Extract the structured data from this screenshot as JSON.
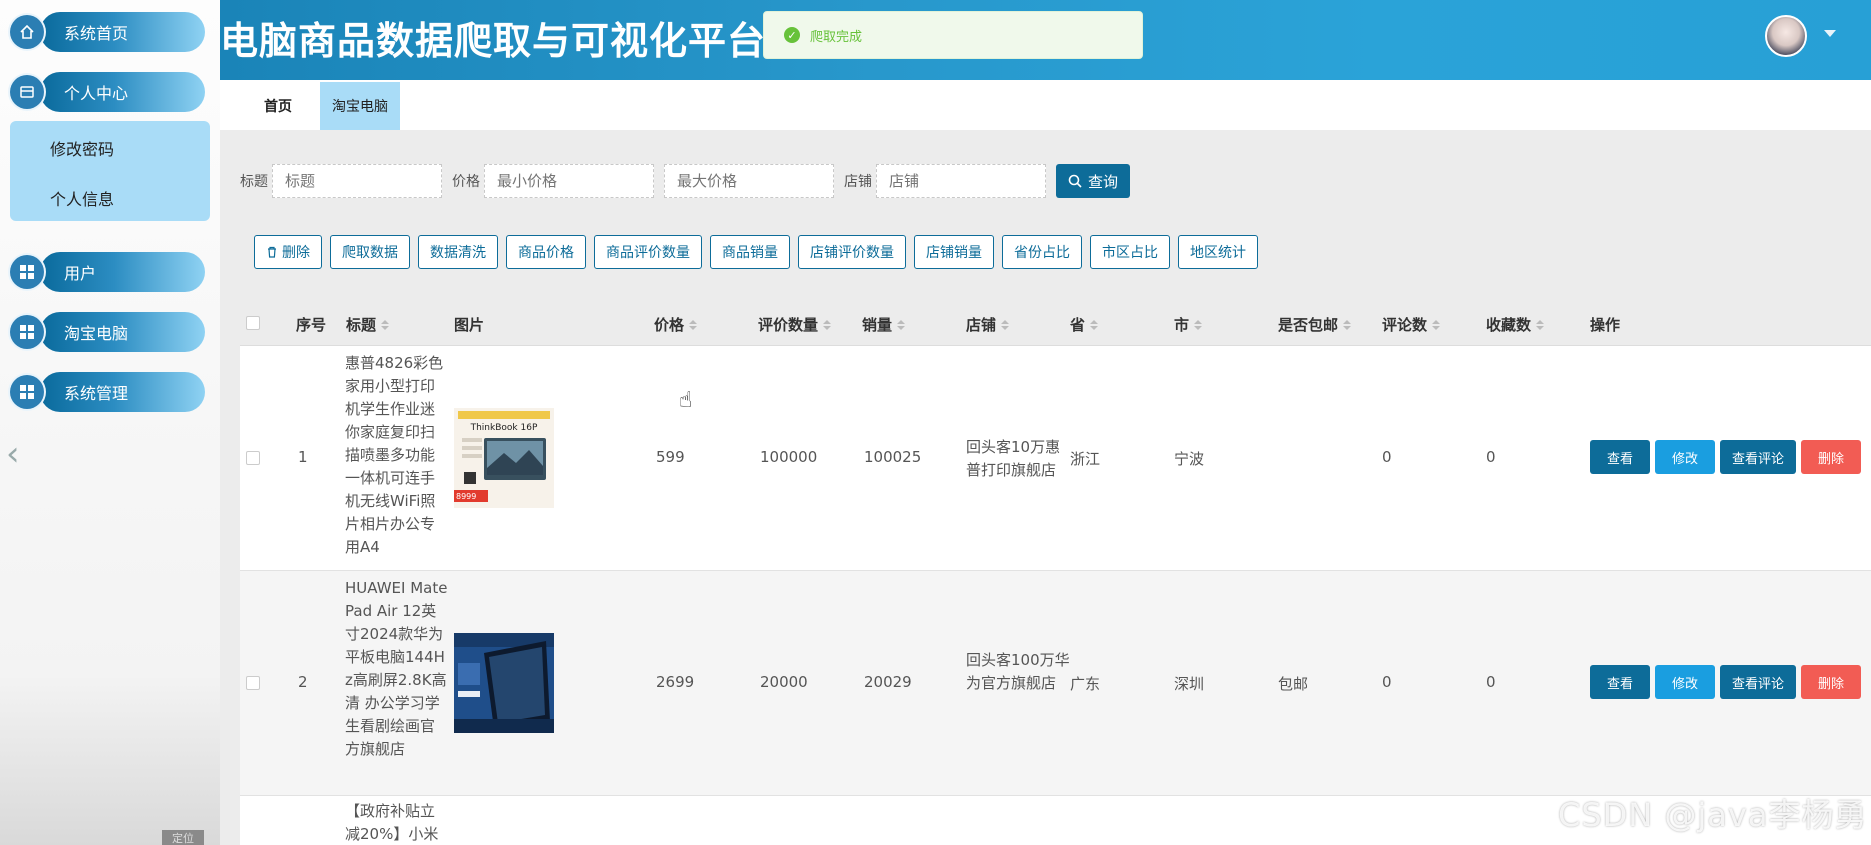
{
  "app": {
    "title": "电脑商品数据爬取与可视化平台"
  },
  "toast": {
    "message": "爬取完成",
    "icon": "check-circle-icon"
  },
  "sidebar": {
    "items": [
      {
        "label": "系统首页",
        "icon": "home-icon"
      },
      {
        "label": "个人中心",
        "icon": "profile-card-icon"
      },
      {
        "label": "用户",
        "icon": "grid-icon"
      },
      {
        "label": "淘宝电脑",
        "icon": "grid-icon"
      },
      {
        "label": "系统管理",
        "icon": "grid-icon"
      }
    ],
    "submenu": [
      {
        "label": "修改密码"
      },
      {
        "label": "个人信息"
      }
    ],
    "collapse_icon": "chevron-left-icon",
    "bottom_tag": "定位"
  },
  "tabs": [
    {
      "label": "首页"
    },
    {
      "label": "淘宝电脑"
    }
  ],
  "search": {
    "title_label": "标题",
    "title_placeholder": "标题",
    "price_label": "价格",
    "min_price_placeholder": "最小价格",
    "max_price_placeholder": "最大价格",
    "shop_label": "店铺",
    "shop_placeholder": "店铺",
    "query_label": "查询"
  },
  "actions": [
    "删除",
    "爬取数据",
    "数据清洗",
    "商品价格",
    "商品评价数量",
    "商品销量",
    "店铺评价数量",
    "店铺销量",
    "省份占比",
    "市区占比",
    "地区统计"
  ],
  "table": {
    "headers": {
      "index": "序号",
      "title": "标题",
      "image": "图片",
      "price": "价格",
      "reviews": "评价数量",
      "sales": "销量",
      "shop": "店铺",
      "province": "省",
      "city": "市",
      "free_shipping": "是否包邮",
      "comments": "评论数",
      "favorites": "收藏数",
      "ops": "操作"
    },
    "rows": [
      {
        "index": "1",
        "title": "惠普4826彩色家用小型打印机学生作业迷你家庭复印扫描喷墨多功能一体机可连手机无线WiFi照片相片办公专用A4",
        "image_caption": "ThinkBook 16P",
        "image_price": "8999",
        "price": "599",
        "reviews": "100000",
        "sales": "100025",
        "shop": "回头客10万惠普打印旗舰店",
        "province": "浙江",
        "city": "宁波",
        "free_shipping": "",
        "comments": "0",
        "favorites": "0"
      },
      {
        "index": "2",
        "title": "HUAWEI MatePad Air 12英寸2024款华为平板电脑144Hz高刷屏2.8K高清 办公学习学生看剧绘画官方旗舰店",
        "image_caption": "",
        "image_price": "",
        "price": "2699",
        "reviews": "20000",
        "sales": "20029",
        "shop": "回头客100万华为官方旗舰店",
        "province": "广东",
        "city": "深圳",
        "free_shipping": "包邮",
        "comments": "0",
        "favorites": "0"
      },
      {
        "index": "",
        "title": "【政府补贴立减20%】小米",
        "image_caption": "",
        "image_price": "",
        "price": "",
        "reviews": "",
        "sales": "",
        "shop": "",
        "province": "",
        "city": "",
        "free_shipping": "",
        "comments": "",
        "favorites": ""
      }
    ],
    "ops": {
      "view": "查看",
      "edit": "修改",
      "comments": "查看评论",
      "delete": "删除"
    }
  },
  "watermark": "CSDN @java李杨勇",
  "colors": {
    "primary": "#0d6c99",
    "accent": "#1a9ee0",
    "danger": "#f25c54",
    "success": "#67c23a",
    "submenu_bg": "#a9dcf7"
  }
}
